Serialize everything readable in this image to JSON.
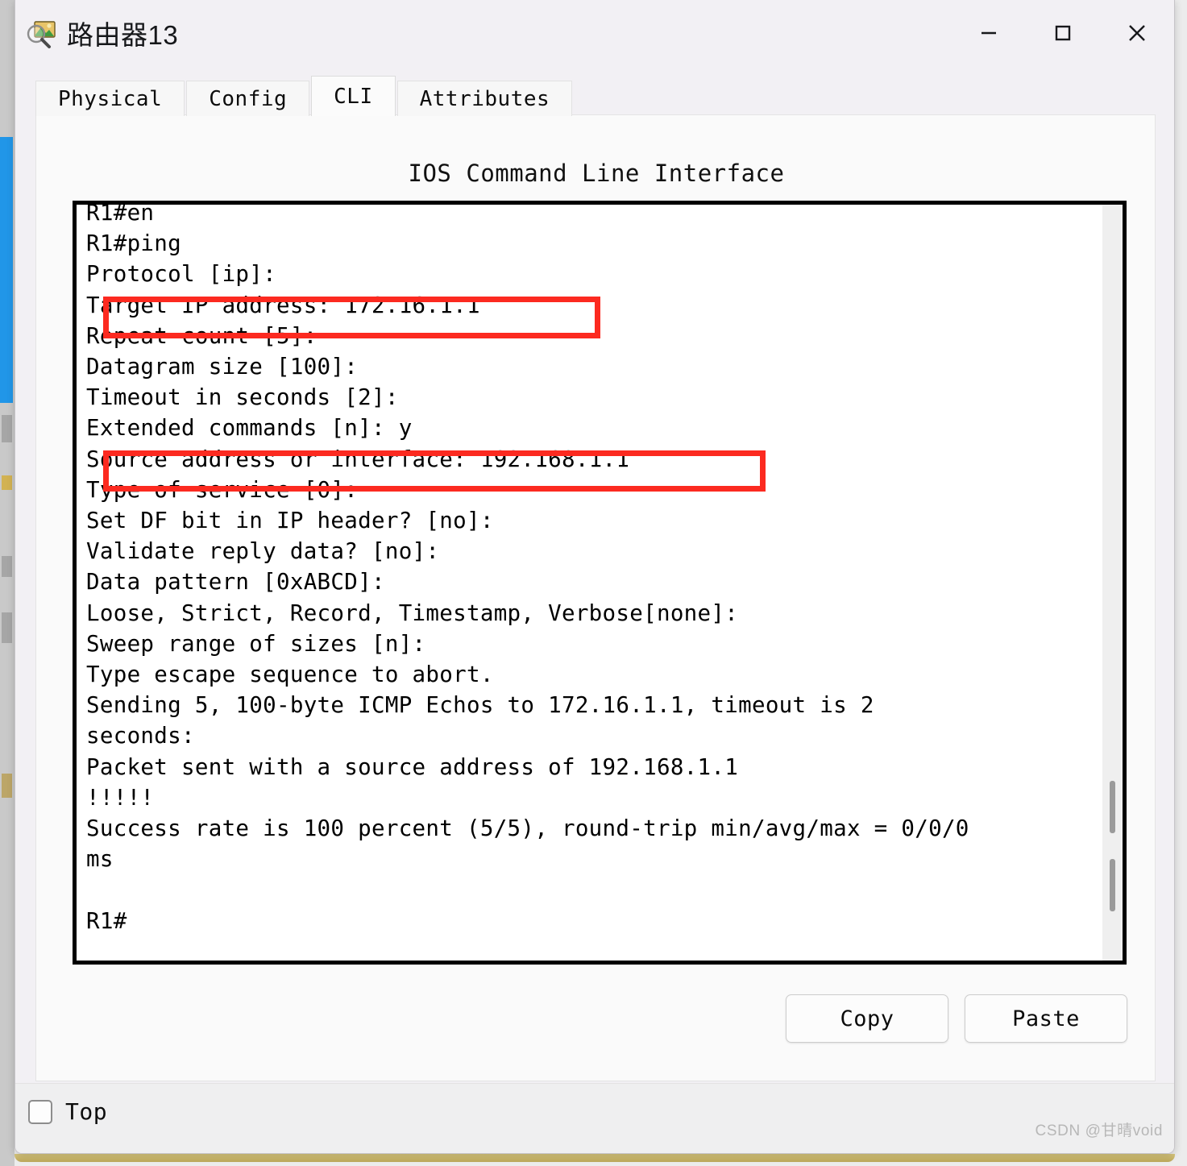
{
  "window": {
    "title": "路由器13",
    "icon": "inspect-magnifier-icon",
    "controls": {
      "minimize": "minimize-icon",
      "maximize": "maximize-icon",
      "close": "close-icon"
    }
  },
  "tabs": [
    {
      "label": "Physical",
      "active": false
    },
    {
      "label": "Config",
      "active": false
    },
    {
      "label": "CLI",
      "active": true
    },
    {
      "label": "Attributes",
      "active": false
    }
  ],
  "cli": {
    "heading": "IOS Command Line Interface",
    "output": "R1#en\nR1#ping\nProtocol [ip]:\nTarget IP address: 172.16.1.1\nRepeat count [5]:\nDatagram size [100]:\nTimeout in seconds [2]:\nExtended commands [n]: y\nSource address or interface: 192.168.1.1\nType of service [0]:\nSet DF bit in IP header? [no]:\nValidate reply data? [no]:\nData pattern [0xABCD]:\nLoose, Strict, Record, Timestamp, Verbose[none]:\nSweep range of sizes [n]:\nType escape sequence to abort.\nSending 5, 100-byte ICMP Echos to 172.16.1.1, timeout is 2\nseconds:\nPacket sent with a source address of 192.168.1.1\n!!!!!\nSuccess rate is 100 percent (5/5), round-trip min/avg/max = 0/0/0\nms\n\nR1#",
    "lines": [
      "R1#en",
      "R1#ping",
      "Protocol [ip]:",
      "Target IP address: 172.16.1.1",
      "Repeat count [5]:",
      "Datagram size [100]:",
      "Timeout in seconds [2]:",
      "Extended commands [n]: y",
      "Source address or interface: 192.168.1.1",
      "Type of service [0]:",
      "Set DF bit in IP header? [no]:",
      "Validate reply data? [no]:",
      "Data pattern [0xABCD]:",
      "Loose, Strict, Record, Timestamp, Verbose[none]:",
      "Sweep range of sizes [n]:",
      "Type escape sequence to abort.",
      "Sending 5, 100-byte ICMP Echos to 172.16.1.1, timeout is 2",
      "seconds:",
      "Packet sent with a source address of 192.168.1.1",
      "!!!!!",
      "Success rate is 100 percent (5/5), round-trip min/avg/max = 0/0/0",
      "ms",
      "",
      "R1#"
    ],
    "prompt": "R1#",
    "highlights": [
      {
        "name": "target-ip-highlight",
        "text": "Target IP address: 172.16.1.1",
        "color": "#fc2a20"
      },
      {
        "name": "source-address-highlight",
        "text": "Source address or interface: 192.168.1.1",
        "color": "#fc2a20"
      }
    ]
  },
  "buttons": {
    "copy": "Copy",
    "paste": "Paste"
  },
  "bottom": {
    "top_checkbox_label": "Top",
    "top_checked": false,
    "watermark": "CSDN @甘晴void"
  }
}
